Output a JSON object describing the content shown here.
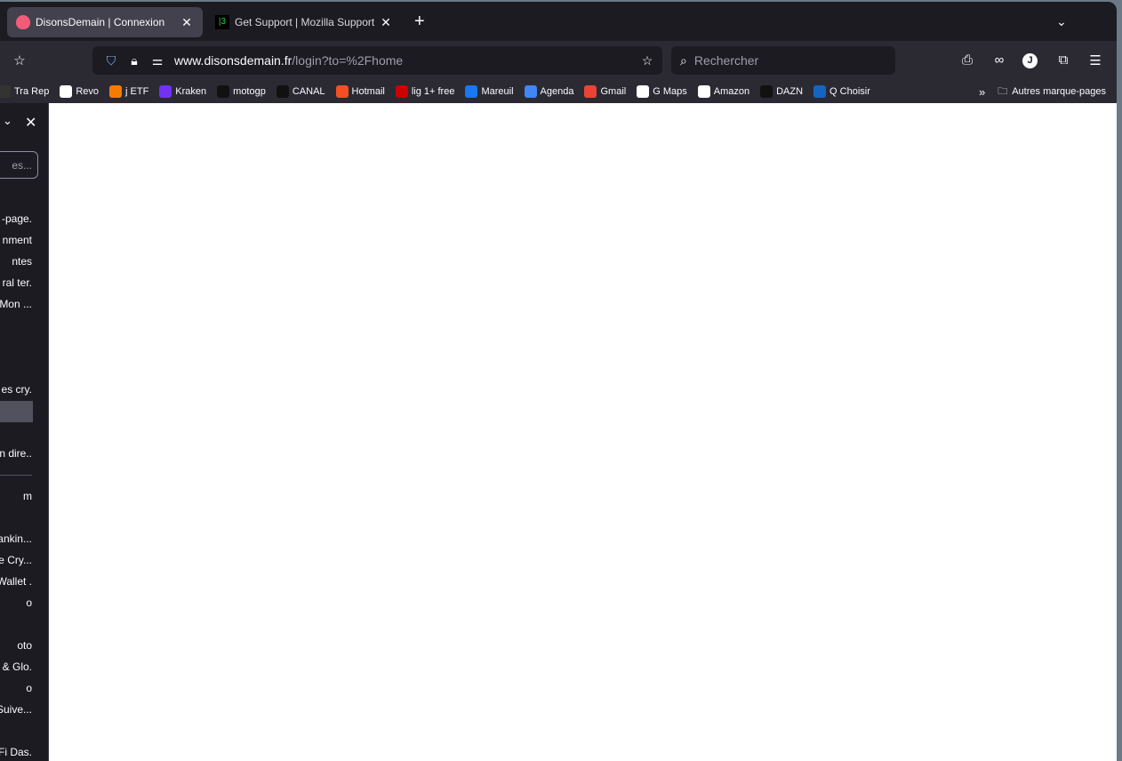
{
  "tabs": [
    {
      "title": "DisonsDemain | Connexion",
      "active": true,
      "icon": "heart-favicon",
      "color": "#f25c7a"
    },
    {
      "title": "Get Support | Mozilla Support",
      "active": false,
      "icon": "terminal-favicon"
    }
  ],
  "toolbar": {
    "url_domain": "www.disonsdemain.fr",
    "url_path": "/login?to=%2Fhome",
    "search_placeholder": "Rechercher",
    "profile_initial": "J"
  },
  "bookmarks": [
    {
      "label": "Tra Rep",
      "color": "#333"
    },
    {
      "label": "Revo",
      "color": "#fff"
    },
    {
      "label": "j ETF",
      "color": "#f57c00"
    },
    {
      "label": "Kraken",
      "color": "#7132f5"
    },
    {
      "label": "motogp",
      "color": "#111"
    },
    {
      "label": "CANAL",
      "color": "#111"
    },
    {
      "label": "Hotmail",
      "color": "#f25022"
    },
    {
      "label": "lig 1+ free",
      "color": "#c00"
    },
    {
      "label": "Mareuil",
      "color": "#1877f2"
    },
    {
      "label": "Agenda",
      "color": "#4285f4"
    },
    {
      "label": "Gmail",
      "color": "#ea4335"
    },
    {
      "label": "G Maps",
      "color": "#fff"
    },
    {
      "label": "Amazon",
      "color": "#fff"
    },
    {
      "label": "DAZN",
      "color": "#111"
    },
    {
      "label": "Q Choisir",
      "color": "#1565c0"
    }
  ],
  "other_bookmarks": "Autres marque-pages",
  "sidebar": {
    "search_placeholder": "es...",
    "items": [
      "-page.",
      "nment",
      "ntes",
      "ral ter.",
      "Mon ...",
      "es cry.",
      "n dire..",
      "m",
      "ankin...",
      "e Cry...",
      "Wallet .",
      "o",
      "oto",
      "& Glo.",
      "o",
      "Suive...",
      "Fi Das."
    ]
  }
}
